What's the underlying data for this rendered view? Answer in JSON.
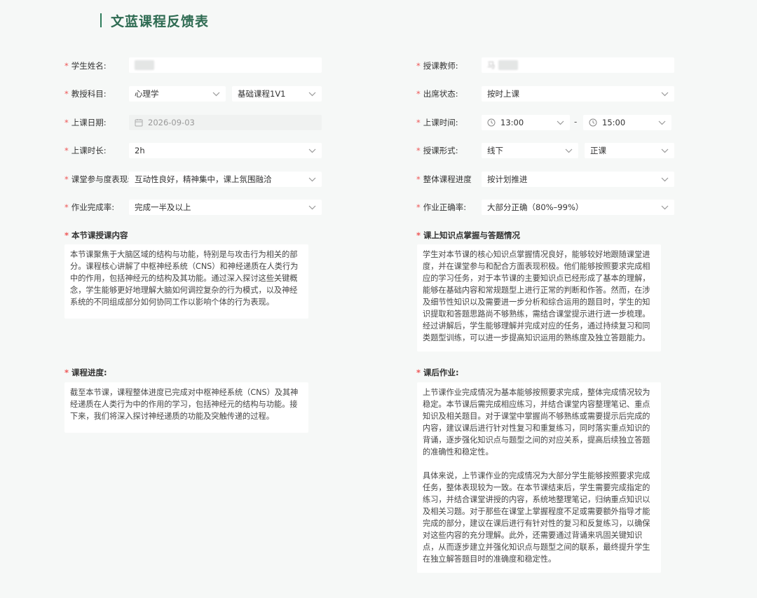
{
  "page_title": "文蓝课程反馈表",
  "labels": {
    "student_name": "学生姓名:",
    "teacher": "授课教师:",
    "subject": "教授科目:",
    "attendance": "出席状态:",
    "date": "上课日期:",
    "time": "上课时间:",
    "duration": "上课时长:",
    "mode": "授课形式:",
    "participation": "课堂参与度表现:",
    "overall_progress": "整体课程进度",
    "hw_completion": "作业完成率:",
    "hw_accuracy": "作业正确率:",
    "content_section": "本节课授课内容",
    "mastery_section": "课上知识点掌握与答题情况",
    "progress_section": "课程进度:",
    "homework_section": "课后作业:"
  },
  "required_mark": "*",
  "fields": {
    "student_name": "",
    "teacher": "马",
    "subject": "心理学",
    "course_type": "基础课程1V1",
    "attendance": "按时上课",
    "date": "2026-09-03",
    "time_start": "13:00",
    "time_end": "15:00",
    "time_separator": "-",
    "duration": "2h",
    "mode": "线下",
    "class_type": "正课",
    "participation": "互动性良好，精神集中，课上氛围融洽",
    "overall_progress": "按计划推进",
    "hw_completion": "完成一半及以上",
    "hw_accuracy": "大部分正确（80%–99%）"
  },
  "texts": {
    "content": "本节课聚焦于大脑区域的结构与功能，特别是与攻击行为相关的部分。课程核心讲解了中枢神经系统（CNS）和神经递质在人类行为中的作用，包括神经元的结构及其功能。通过深入探讨这些关键概念，学生能够更好地理解大脑如何调控复杂的行为模式，以及神经系统的不同组成部分如何协同工作以影响个体的行为表现。",
    "mastery": "学生对本节课的核心知识点掌握情况良好，能够较好地跟随课堂进度，并在课堂参与和配合方面表现积极。他们能够按照要求完成相应的学习任务，对于本节课的主要知识点已经形成了基本的理解，能够在基础内容和常规题型上进行正常的判断和作答。然而，在涉及细节性知识以及需要进一步分析和综合运用的题目时，学生的知识提取和答题思路尚不够熟练，需结合课堂提示进行进一步梳理。经过讲解后，学生能够理解并完成对应的任务，通过持续复习和同类题型训练，可以进一步提高知识运用的熟练度及独立答题能力。",
    "progress": "截至本节课，课程整体进度已完成对中枢神经系统（CNS）及其神经递质在人类行为中的作用的学习，包括神经元的结构与功能。接下来，我们将深入探讨神经递质的功能及突触传递的过程。",
    "homework": "上节课作业完成情况为基本能够按照要求完成，整体完成情况较为稳定。本节课后需完成相应练习，并结合课堂内容整理笔记、重点知识及相关题目。对于课堂中掌握尚不够熟练或需要提示后完成的内容，建议课后进行针对性复习和重复练习，同时落实重点知识的背诵，逐步强化知识点与题型之间的对应关系，提高后续独立答题的准确性和稳定性。\n\n具体来说，上节课作业的完成情况为大部分学生能够按照要求完成任务，整体表现较为一致。在本节课结束后，学生需要完成指定的练习，并结合课堂讲授的内容，系统地整理笔记，归纳重点知识以及相关习题。对于那些在课堂上掌握程度不足或需要额外指导才能完成的部分，建议在课后进行有针对性的复习和反复练习，以确保对这些内容的充分理解。此外，还需要通过背诵来巩固关键知识点，从而逐步建立并强化知识点与题型之间的联系，最终提升学生在独立解答题目时的准确度和稳定性。"
  },
  "icons": {
    "select": "chevron-down-icon",
    "date": "calendar-icon",
    "time": "clock-icon"
  },
  "colors": {
    "accent": "#2e7d5b",
    "required": "#ee5555",
    "background": "#f6f8f7"
  }
}
